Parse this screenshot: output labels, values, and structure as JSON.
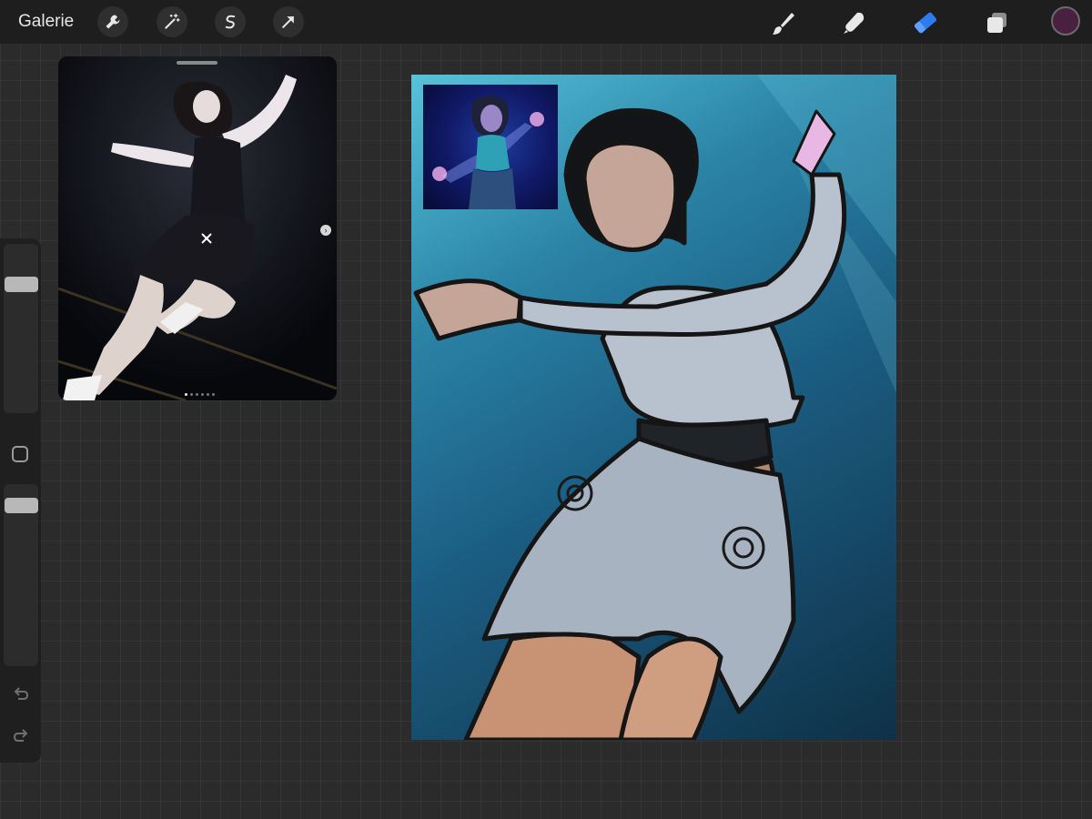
{
  "app": {
    "gallery_label": "Galerie"
  },
  "toolbar": {
    "left_tools": [
      "actions-icon",
      "adjustments-icon",
      "selection-icon",
      "transform-icon"
    ],
    "right_tools": [
      "brush-icon",
      "smudge-icon",
      "eraser-icon",
      "layers-icon"
    ],
    "active_tool": "eraser-icon",
    "current_color": "#4a2040",
    "accent": "#2c7bf0"
  },
  "sidebar": {
    "brush_size_level": 0.05,
    "opacity_level": 0.07
  },
  "reference": {
    "page_count": 6,
    "active_page": 1
  }
}
